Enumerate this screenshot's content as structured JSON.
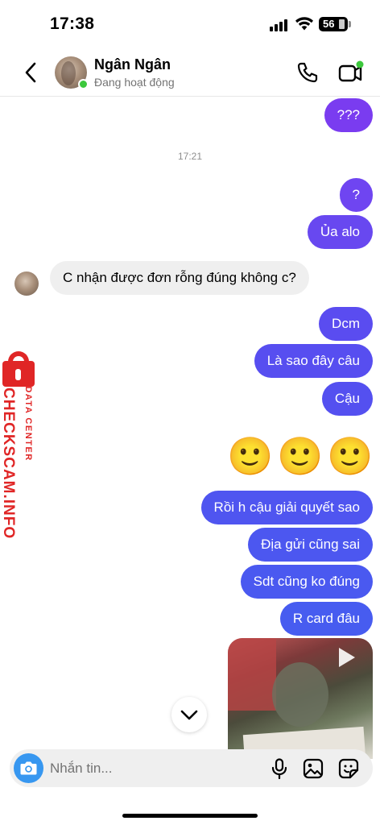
{
  "status_bar": {
    "time": "17:38",
    "battery": "56"
  },
  "header": {
    "name": "Ngân Ngân",
    "status": "Đang hoạt động"
  },
  "messages": [
    {
      "text": "???",
      "side": "out",
      "color": "#7a3cf0"
    },
    {
      "text": "?",
      "side": "out",
      "color": "#6f45f1"
    },
    {
      "text": "Ủa alo",
      "side": "out",
      "color": "#6848f0"
    },
    {
      "text": "C nhận được đơn rỗng đúng không c?",
      "side": "in"
    },
    {
      "text": "Dcm",
      "side": "out",
      "color": "#5a4cf0"
    },
    {
      "text": "Là sao đây câu",
      "side": "out",
      "color": "#574ef0"
    },
    {
      "text": "Cậu",
      "side": "out",
      "color": "#5450f0"
    },
    {
      "text": "Rồi h cậu giải quyết sao",
      "side": "out",
      "color": "#4f55f0"
    },
    {
      "text": "Địa gửi cũng sai",
      "side": "out",
      "color": "#4c57f0"
    },
    {
      "text": "Sdt cũng ko đúng",
      "side": "out",
      "color": "#4a59f0"
    },
    {
      "text": "R card đâu",
      "side": "out",
      "color": "#475cf0"
    }
  ],
  "timestamp": "17:21",
  "emojis": [
    "🙂",
    "🙂",
    "🙂"
  ],
  "watermark": {
    "main": "CHECKSCAM.INFO",
    "sub": "DATA CENTER"
  },
  "composer": {
    "placeholder": "Nhắn tin..."
  }
}
